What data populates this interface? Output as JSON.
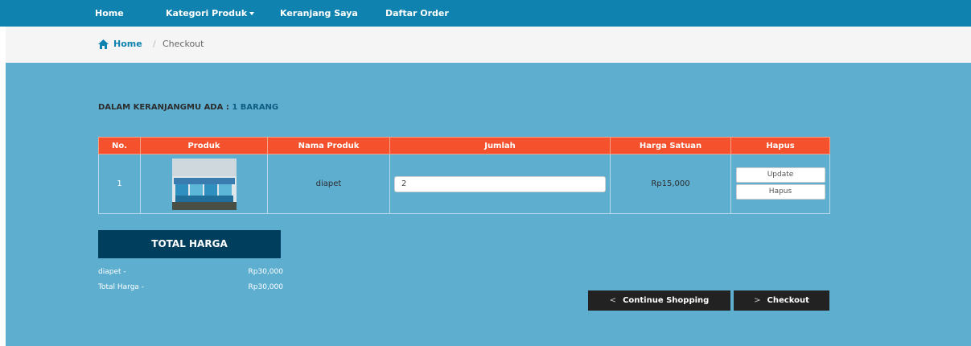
{
  "nav": {
    "home": "Home",
    "categories": "Kategori Produk",
    "cart": "Keranjang Saya",
    "orders": "Daftar Order"
  },
  "breadcrumb": {
    "home": "Home",
    "separator": "/",
    "current": "Checkout"
  },
  "cart": {
    "heading_prefix": "DALAM KERANJANGMU ADA :",
    "heading_count": "1 BARANG",
    "columns": [
      "No.",
      "Produk",
      "Nama Produk",
      "Jumlah",
      "Harga Satuan",
      "Hapus"
    ],
    "rows": [
      {
        "no": "1",
        "name": "diapet",
        "qty": "2",
        "unit_price": "Rp15,000",
        "update_label": "Update",
        "delete_label": "Hapus"
      }
    ]
  },
  "total": {
    "title": "TOTAL HARGA",
    "items": [
      {
        "label": "diapet -",
        "value": "Rp30,000"
      },
      {
        "label": "Total Harga -",
        "value": "Rp30,000"
      }
    ]
  },
  "actions": {
    "continue": "Continue Shopping",
    "checkout": "Checkout"
  },
  "colors": {
    "navbar": "#0f82b0",
    "main_bg": "#5eaed0",
    "table_header": "#f4512c",
    "total_box": "#003e5e",
    "dark_button": "#222222"
  }
}
